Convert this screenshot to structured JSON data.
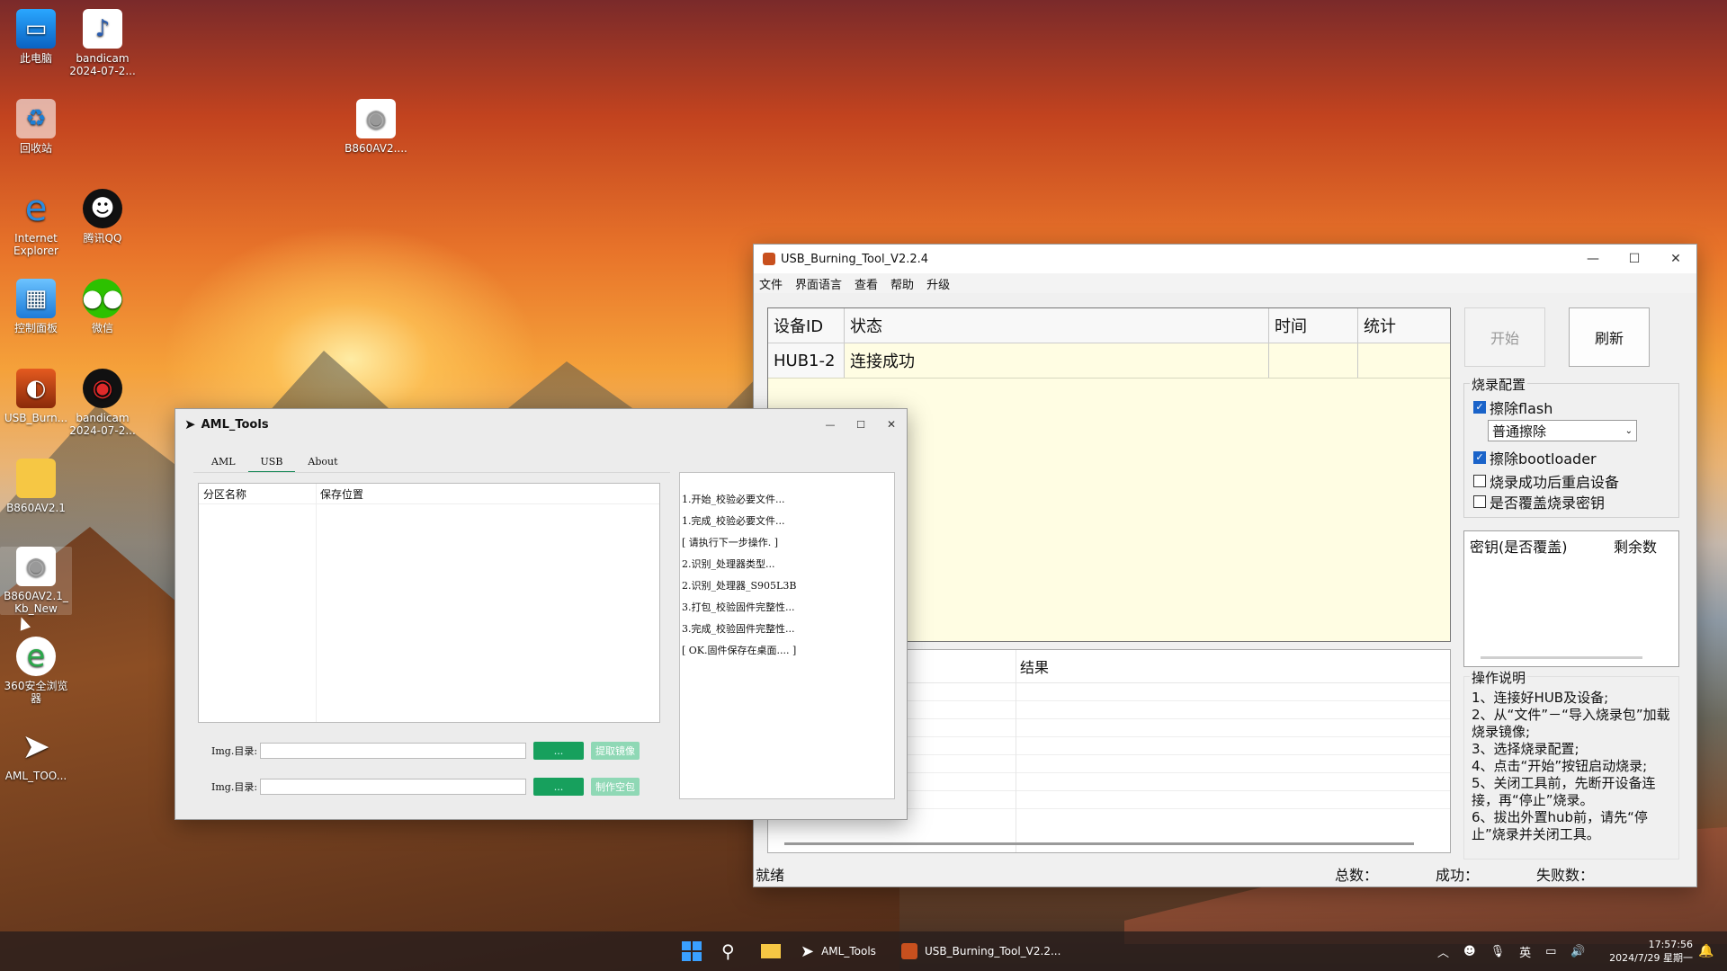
{
  "desktop_icons": [
    {
      "label": "此电脑",
      "icon": "monitor-icon"
    },
    {
      "label": "bandicam\n2024-07-2...",
      "icon": "video-file-icon"
    },
    {
      "label": "回收站",
      "icon": "recycle-bin-icon"
    },
    {
      "label": "B860AV2....",
      "icon": "disk-image-icon"
    },
    {
      "label": "Internet\nExplorer",
      "icon": "ie-icon"
    },
    {
      "label": "腾讯QQ",
      "icon": "qq-penguin-icon"
    },
    {
      "label": "控制面板",
      "icon": "control-panel-icon"
    },
    {
      "label": "微信",
      "icon": "wechat-icon"
    },
    {
      "label": "USB_Burn...",
      "icon": "usb-burning-icon"
    },
    {
      "label": "bandicam\n2024-07-2...",
      "icon": "bandicam-icon"
    },
    {
      "label": "B860AV2.1",
      "icon": "folder-icon"
    },
    {
      "label": "B860AV2.1_\nKb_New",
      "icon": "disk-image-icon"
    },
    {
      "label": "360安全浏览\n器",
      "icon": "360-browser-icon"
    },
    {
      "label": "AML_TOO...",
      "icon": "aml-tool-icon"
    }
  ],
  "usb_tool": {
    "title": "USB_Burning_Tool_V2.2.4",
    "menu": [
      "文件",
      "界面语言",
      "查看",
      "帮助",
      "升级"
    ],
    "grid_headers": [
      "设备ID",
      "状态",
      "时间",
      "统计"
    ],
    "grid_rows": [
      {
        "id": "HUB1-2",
        "status": "连接成功",
        "time": "",
        "stats": ""
      }
    ],
    "start_button": "开始",
    "refresh_button": "刷新",
    "burn_config": {
      "title": "烧录配置",
      "erase_flash": "擦除flash",
      "erase_flash_checked": true,
      "erase_mode": "普通擦除",
      "erase_bootloader": "擦除bootloader",
      "erase_bootloader_checked": true,
      "reboot_after": "烧录成功后重启设备",
      "reboot_after_checked": false,
      "overwrite_key": "是否覆盖烧录密钥",
      "overwrite_key_checked": false
    },
    "key_headers": [
      "密钥(是否覆盖)",
      "剩余数"
    ],
    "result_header": "结果",
    "instructions_title": "操作说明",
    "instructions": [
      "1、连接好HUB及设备;",
      "2、从“文件”－“导入烧录包”加载烧录镜像;",
      "3、选择烧录配置;",
      "4、点击“开始”按钮启动烧录;",
      "5、关闭工具前，先断开设备连接，再“停止”烧录。",
      "6、拔出外置hub前，请先“停止”烧录并关闭工具。"
    ],
    "status": {
      "ready": "就绪",
      "total": "总数：",
      "success": "成功：",
      "fail": "失败数："
    }
  },
  "aml_tools": {
    "title": "AML_Tools",
    "tabs": [
      "AML",
      "USB",
      "About"
    ],
    "active_tab": "USB",
    "table_headers": [
      "分区名称",
      "保存位置"
    ],
    "log": [
      "1.开始_校验必要文件...",
      "1.完成_校验必要文件...",
      "[ 请执行下一步操作. ]",
      "2.识别_处理器类型...",
      "2.识别_处理器_S905L3B",
      "3.打包_校验固件完整性...",
      "3.完成_校验固件完整性...",
      "[ OK.固件保存在桌面.... ]"
    ],
    "row1_label": "Img.目录:",
    "row1_browse": "...",
    "row1_action": "提取镜像",
    "row2_label": "Img.目录:",
    "row2_browse": "...",
    "row2_action": "制作空包"
  },
  "taskbar": {
    "apps": [
      {
        "label": "AML_Tools",
        "icon": "aml-tool-icon"
      },
      {
        "label": "USB_Burning_Tool_V2.2...",
        "icon": "usb-burning-icon"
      }
    ],
    "tray_lang": "英",
    "time": "17:57:56",
    "date": "2024/7/29 星期一"
  },
  "colors": {
    "accent_green": "#17a05d",
    "grid_yellow": "#fffde3",
    "check_blue": "#1a63c9"
  }
}
